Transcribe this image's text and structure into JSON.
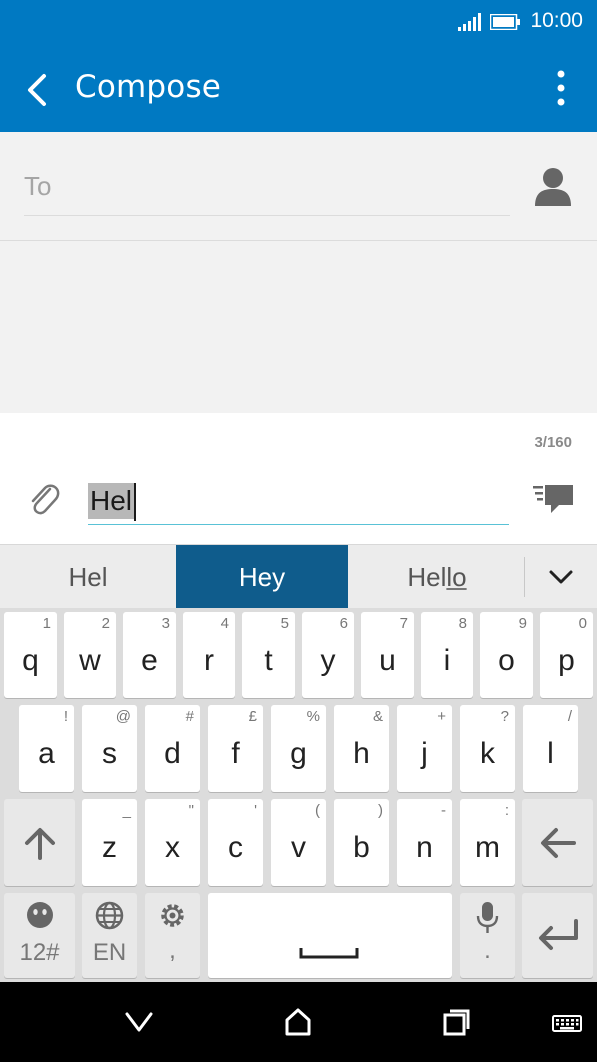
{
  "status_bar": {
    "time": "10:00",
    "signal_icon": "signal-icon",
    "battery_icon": "battery-icon"
  },
  "app_bar": {
    "title": "Compose",
    "back_icon": "back-arrow-icon",
    "menu_icon": "overflow-menu-icon"
  },
  "compose": {
    "to_placeholder": "To",
    "contact_icon": "person-icon",
    "char_count": "3/160",
    "message_text": "Hel",
    "attach_icon": "paperclip-icon",
    "send_icon": "send-message-icon"
  },
  "suggestions": {
    "items": [
      "Hel",
      "Hey"
    ],
    "third_prefix": "Hel",
    "third_underlined": "lo",
    "selected": "Hey",
    "expand_icon": "chevron-down-icon"
  },
  "keyboard": {
    "row1": [
      {
        "key": "q",
        "sub": "1"
      },
      {
        "key": "w",
        "sub": "2"
      },
      {
        "key": "e",
        "sub": "3"
      },
      {
        "key": "r",
        "sub": "4"
      },
      {
        "key": "t",
        "sub": "5"
      },
      {
        "key": "y",
        "sub": "6"
      },
      {
        "key": "u",
        "sub": "7"
      },
      {
        "key": "i",
        "sub": "8"
      },
      {
        "key": "o",
        "sub": "9"
      },
      {
        "key": "p",
        "sub": "0"
      }
    ],
    "row2": [
      {
        "key": "a",
        "sub": "!"
      },
      {
        "key": "s",
        "sub": "@"
      },
      {
        "key": "d",
        "sub": "#"
      },
      {
        "key": "f",
        "sub": "£"
      },
      {
        "key": "g",
        "sub": "%"
      },
      {
        "key": "h",
        "sub": "&"
      },
      {
        "key": "j",
        "sub": "+"
      },
      {
        "key": "k",
        "sub": "?"
      },
      {
        "key": "l",
        "sub": "/"
      }
    ],
    "row3": [
      {
        "key": "z",
        "sub": "_"
      },
      {
        "key": "x",
        "sub": "\""
      },
      {
        "key": "c",
        "sub": "'"
      },
      {
        "key": "v",
        "sub": "("
      },
      {
        "key": "b",
        "sub": ")"
      },
      {
        "key": "n",
        "sub": "-"
      },
      {
        "key": "m",
        "sub": ":"
      }
    ],
    "shift_icon": "shift-arrow-icon",
    "backspace_icon": "backspace-arrow-icon",
    "emoji_label": "12#",
    "emoji_icon": "emoji-icon",
    "language_label": "EN",
    "globe_icon": "globe-icon",
    "settings_sub": ",",
    "settings_icon": "gear-icon",
    "space_icon": "space-bar-icon",
    "mic_icon": "microphone-icon",
    "mic_sub": ".",
    "enter_icon": "enter-icon"
  },
  "nav_bar": {
    "back_icon": "nav-back-icon",
    "home_icon": "nav-home-icon",
    "recents_icon": "nav-recents-icon",
    "keyboard_icon": "keyboard-switch-icon"
  }
}
